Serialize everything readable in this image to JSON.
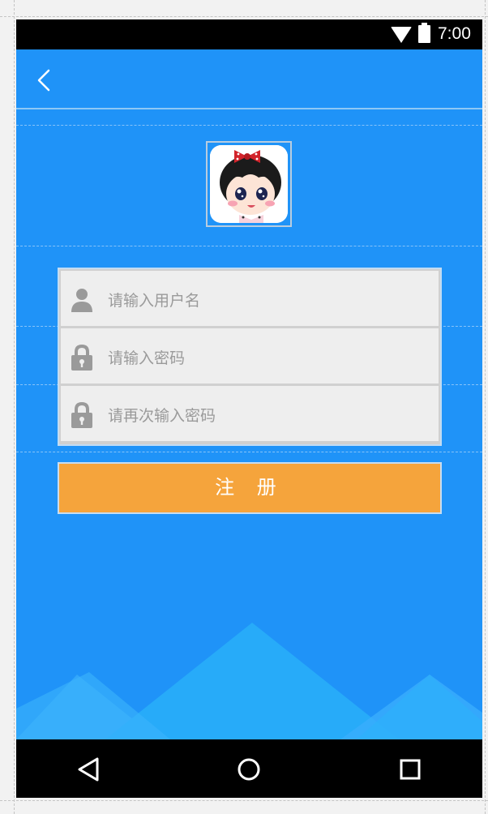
{
  "status_bar": {
    "time": "7:00",
    "wifi_icon": "wifi-icon",
    "battery_icon": "battery-icon"
  },
  "toolbar": {
    "back_icon": "chevron-left-icon"
  },
  "avatar": {
    "icon": "cartoon-girl-avatar"
  },
  "form": {
    "username": {
      "placeholder": "请输入用户名",
      "icon": "user-icon"
    },
    "password": {
      "placeholder": "请输入密码",
      "icon": "lock-icon"
    },
    "confirm_password": {
      "placeholder": "请再次输入密码",
      "icon": "lock-icon"
    }
  },
  "register_button": {
    "label": "注 册"
  },
  "nav_bar": {
    "back": "triangle-back-icon",
    "home": "circle-home-icon",
    "recents": "square-recents-icon"
  },
  "colors": {
    "background": "#1f93f8",
    "button": "#f5a43c",
    "field": "#eeeeee",
    "icon_gray": "#9a9a9a"
  }
}
